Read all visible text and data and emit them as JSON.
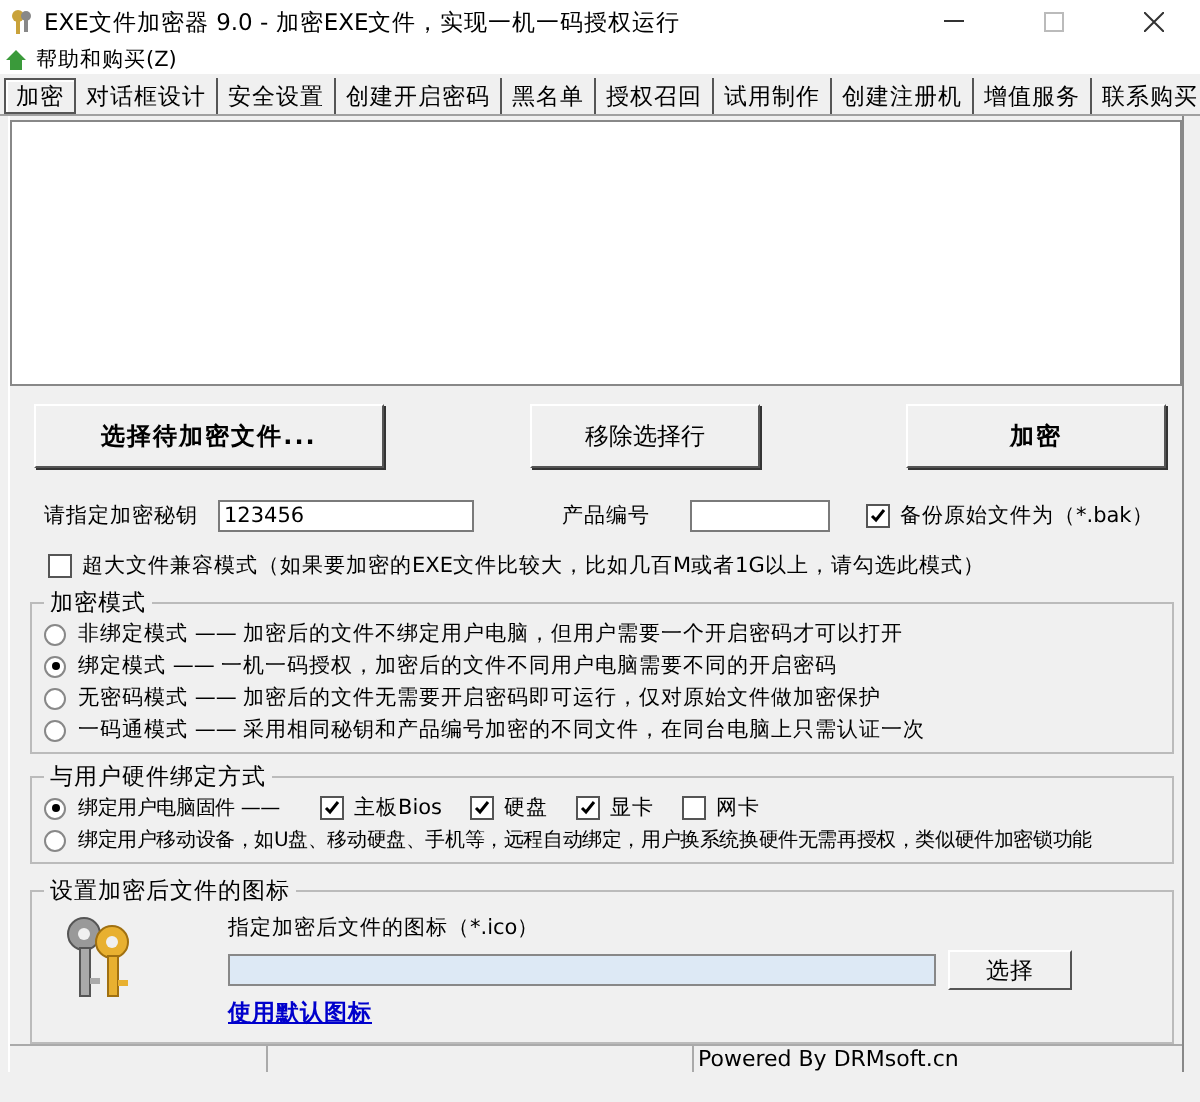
{
  "window": {
    "title": "EXE文件加密器 9.0 - 加密EXE文件，实现一机一码授权运行"
  },
  "menu": [
    {
      "label": "帮助和购买(Z)"
    }
  ],
  "tabs": [
    {
      "label": "加密",
      "selected": true
    },
    {
      "label": "对话框设计",
      "selected": false
    },
    {
      "label": "安全设置",
      "selected": false
    },
    {
      "label": "创建开启密码",
      "selected": false
    },
    {
      "label": "黑名单",
      "selected": false
    },
    {
      "label": "授权召回",
      "selected": false
    },
    {
      "label": "试用制作",
      "selected": false
    },
    {
      "label": "创建注册机",
      "selected": false
    },
    {
      "label": "增值服务",
      "selected": false
    },
    {
      "label": "联系购买",
      "selected": false
    }
  ],
  "buttons": [
    {
      "label": "选择待加密文件...",
      "bold": true
    },
    {
      "label": "移除选择行",
      "bold": false
    },
    {
      "label": "加密",
      "bold": true
    }
  ],
  "key_field": {
    "label": "请指定加密秘钥",
    "value": "123456"
  },
  "product_field": {
    "label": "产品编号"
  },
  "backup": {
    "label": "备份原始文件为（*.bak）",
    "checked": true
  },
  "large_file": {
    "label": "超大文件兼容模式（如果要加密的EXE文件比较大，比如几百M或者1G以上，请勾选此模式）",
    "checked": false
  },
  "encrypt_mode": {
    "title": "加密模式",
    "options": [
      {
        "label": "非绑定模式 —— 加密后的文件不绑定用户电脑，但用户需要一个开启密码才可以打开",
        "selected": false
      },
      {
        "label": "绑定模式 —— 一机一码授权，加密后的文件不同用户电脑需要不同的开启密码",
        "selected": true
      },
      {
        "label": "无密码模式 —— 加密后的文件无需要开启密码即可运行，仅对原始文件做加密保护",
        "selected": false
      },
      {
        "label": "一码通模式 —— 采用相同秘钥和产品编号加密的不同文件，在同台电脑上只需认证一次",
        "selected": false
      }
    ]
  },
  "binding": {
    "title": "与用户硬件绑定方式",
    "options": [
      {
        "label": "绑定用户电脑固件 ——",
        "selected": true,
        "hardware": [
          {
            "label": "主板Bios",
            "checked": true
          },
          {
            "label": "硬盘",
            "checked": true
          },
          {
            "label": "显卡",
            "checked": true
          },
          {
            "label": "网卡",
            "checked": false
          }
        ]
      },
      {
        "label": "绑定用户移动设备，如U盘、移动硬盘、手机等，远程自动绑定，用户换系统换硬件无需再授权，类似硬件加密锁功能",
        "selected": false
      }
    ]
  },
  "icon_group": {
    "title": "设置加密后文件的图标",
    "field_label": "指定加密后文件的图标（*.ico）",
    "browse_button": "选择",
    "default_link": "使用默认图标"
  },
  "status_bar": {
    "text": "Powered By DRMsoft.cn"
  }
}
